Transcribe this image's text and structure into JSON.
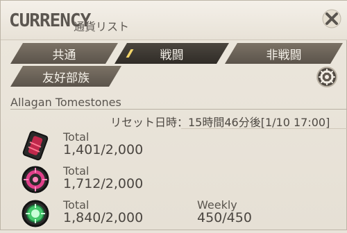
{
  "window": {
    "title": "CURRENCY",
    "subtitle": "通貨リスト"
  },
  "tabs": [
    {
      "label": "共通",
      "active": false
    },
    {
      "label": "戦闘",
      "active": true
    },
    {
      "label": "非戦闘",
      "active": false
    },
    {
      "label": "友好部族",
      "active": false
    }
  ],
  "section": {
    "title": "Allagan Tomestones",
    "reset_text": "リセット日時：15時間46分後[1/10 17:00]"
  },
  "currencies": [
    {
      "total_label": "Total",
      "total_value": "1,401/2,000",
      "icon": "tomestone-red-icon"
    },
    {
      "total_label": "Total",
      "total_value": "1,712/2,000",
      "icon": "tomestone-pink-icon"
    },
    {
      "total_label": "Total",
      "total_value": "1,840/2,000",
      "weekly_label": "Weekly",
      "weekly_value": "450/450",
      "icon": "tomestone-green-icon"
    }
  ],
  "colors": {
    "accent": "#f3d56a",
    "tab_dark": "#302c27",
    "tab_normal": "#6a6257"
  }
}
